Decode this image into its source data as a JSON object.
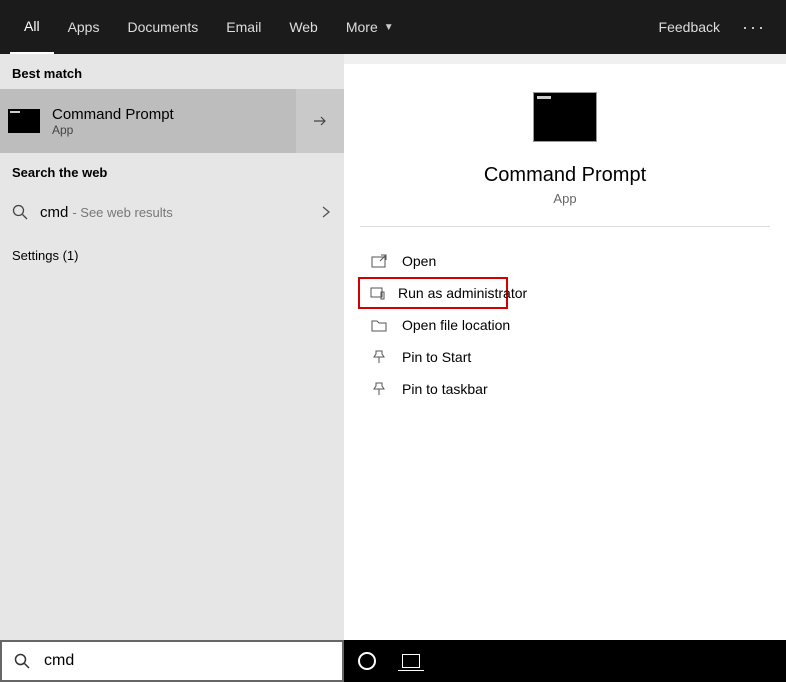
{
  "tabs": {
    "all": "All",
    "apps": "Apps",
    "documents": "Documents",
    "email": "Email",
    "web": "Web",
    "more": "More"
  },
  "header": {
    "feedback": "Feedback"
  },
  "left": {
    "best_match": "Best match",
    "match_title": "Command Prompt",
    "match_sub": "App",
    "search_web": "Search the web",
    "web_query": "cmd",
    "web_hint": "- See web results",
    "settings": "Settings (1)"
  },
  "preview": {
    "title": "Command Prompt",
    "sub": "App"
  },
  "actions": {
    "open": "Open",
    "admin": "Run as administrator",
    "location": "Open file location",
    "pin_start": "Pin to Start",
    "pin_taskbar": "Pin to taskbar"
  },
  "search": {
    "value": "cmd"
  }
}
